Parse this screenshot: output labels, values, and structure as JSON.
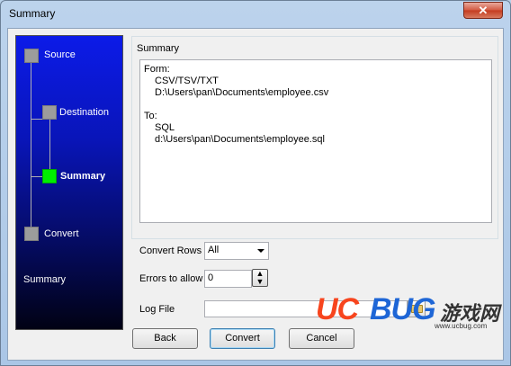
{
  "window": {
    "title": "Summary",
    "close_glyph": "✕"
  },
  "steps": [
    {
      "label": "Source",
      "active": false
    },
    {
      "label": "Destination",
      "active": false
    },
    {
      "label": "Summary",
      "active": true
    },
    {
      "label": "Convert",
      "active": false
    }
  ],
  "side_caption": "Summary",
  "summary_group": {
    "label": "Summary",
    "lines": {
      "form_label": "Form:",
      "form_type": "CSV/TSV/TXT",
      "form_path": "D:\\Users\\pan\\Documents\\employee.csv",
      "to_label": "To:",
      "to_type": "SQL",
      "to_path": "d:\\Users\\pan\\Documents\\employee.sql"
    }
  },
  "convert_rows": {
    "label": "Convert Rows",
    "value": "All"
  },
  "errors_to_allow": {
    "label": "Errors to allow",
    "value": "0"
  },
  "log_file": {
    "label": "Log File",
    "value": ""
  },
  "buttons": {
    "back": "Back",
    "convert": "Convert",
    "cancel": "Cancel"
  },
  "watermark": {
    "uc": "UC",
    "bug": "BUG",
    "cn": "游戏网",
    "url": "www.ucbug.com"
  },
  "colors": {
    "active_step": "#00ee00",
    "panel_top": "#0c1be8",
    "panel_bottom": "#010214"
  }
}
